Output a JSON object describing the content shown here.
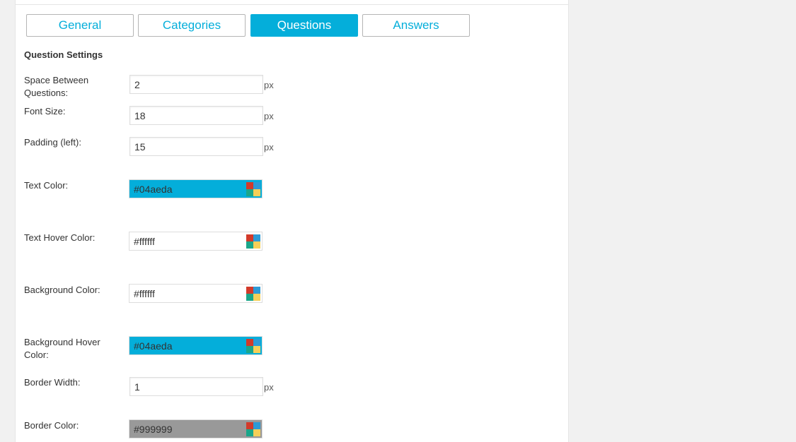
{
  "tabs": [
    {
      "label": "General",
      "active": false
    },
    {
      "label": "Categories",
      "active": false
    },
    {
      "label": "Questions",
      "active": true
    },
    {
      "label": "Answers",
      "active": false
    }
  ],
  "section_title": "Question Settings",
  "fields": {
    "space_between": {
      "label": "Space Between Questions:",
      "value": "2",
      "unit": "px"
    },
    "font_size": {
      "label": "Font Size:",
      "value": "18",
      "unit": "px"
    },
    "padding_left": {
      "label": "Padding (left):",
      "value": "15",
      "unit": "px"
    },
    "text_color": {
      "label": "Text Color:",
      "value": "#04aeda",
      "swatch": "#04aeda"
    },
    "text_hover_color": {
      "label": "Text Hover Color:",
      "value": "#ffffff",
      "swatch": "#ffffff"
    },
    "background_color": {
      "label": "Background Color:",
      "value": "#ffffff",
      "swatch": "#ffffff"
    },
    "background_hover_color": {
      "label": "Background Hover Color:",
      "value": "#04aeda",
      "swatch": "#04aeda"
    },
    "border_width": {
      "label": "Border Width:",
      "value": "1",
      "unit": "px"
    },
    "border_color": {
      "label": "Border Color:",
      "value": "#999999",
      "swatch": "#999999"
    }
  },
  "icons": {
    "color_picker": "color-palette-icon"
  },
  "colors": {
    "accent": "#04aeda",
    "picker_red": "#d23a2a",
    "picker_blue": "#2d9ad6",
    "picker_teal": "#1aa68a",
    "picker_yellow": "#f5cf58"
  }
}
